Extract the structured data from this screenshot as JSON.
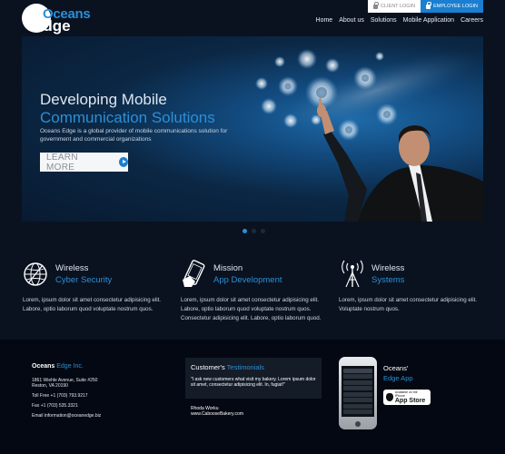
{
  "brand": {
    "line1": "Oceans",
    "line2": "Edge"
  },
  "login": {
    "client_label": "CLIENT LOGIN",
    "employee_label": "EMPLOYEE LOGIN"
  },
  "nav": {
    "items": [
      "Home",
      "About us",
      "Solutions",
      "Mobile Application",
      "Careers"
    ]
  },
  "hero": {
    "title_line1": "Developing Mobile",
    "title_line2": "Communication Solutions",
    "description": "Oceans Edge is a global provider of mobile communications solution for government and commercial organizations",
    "cta_label": "LEARN MORE",
    "slides_total": 3,
    "slide_active": 1
  },
  "features": [
    {
      "title1": "Wireless",
      "title2": "Cyber Security",
      "icon": "globe-icon",
      "text": "Lorem, ipsum dolor sit amet consectetur adipisicing elit. Labore, optio laborum quod voluptate nostrum quos."
    },
    {
      "title1": "Mission",
      "title2": "App Development",
      "icon": "phone-touch-icon",
      "text": "Lorem, ipsum dolor sit amet consectetur adipisicing elit. Labore, optio laborum quod voluptate nostrum quos. Consectetur adipisicing elit. Labore, optio laborum quod."
    },
    {
      "title1": "Wireless",
      "title2": "Systems",
      "icon": "antenna-icon",
      "text": "Lorem, ipsum dolor sit amet consectetur adipisicing elit. Voluptate nostrum quos."
    }
  ],
  "footer": {
    "company_title": "Oceans",
    "company_title_accent": "Edge Inc.",
    "address1": "1861 Wiehle Avenue, Suite #250",
    "address2": "Reston, VA 20190",
    "tollfree": "Toll Free +1 (703) 793.9217",
    "fax": "Fax +1 (703) 535.3321",
    "email": "Email information@oceanedge.biz",
    "testimonial_title": "Customer's",
    "testimonial_title_accent": "Testimonials",
    "testimonial_quote": "\"I ask new customers what visit my bakery. Lorem ipsum dolor sit amet, consectetur adipisicing elit. In, fugiat!\"",
    "testimonial_name": "Rhoda Worku",
    "testimonial_site": "www.CabooseBakery.com",
    "app_title1": "Oceans'",
    "app_title2": "Edge App",
    "appstore_small": "Available on the iPhone",
    "appstore_big": "App Store"
  },
  "colors": {
    "accent": "#2b8fd6",
    "background": "#0a1220",
    "footer_bg": "#030812"
  }
}
